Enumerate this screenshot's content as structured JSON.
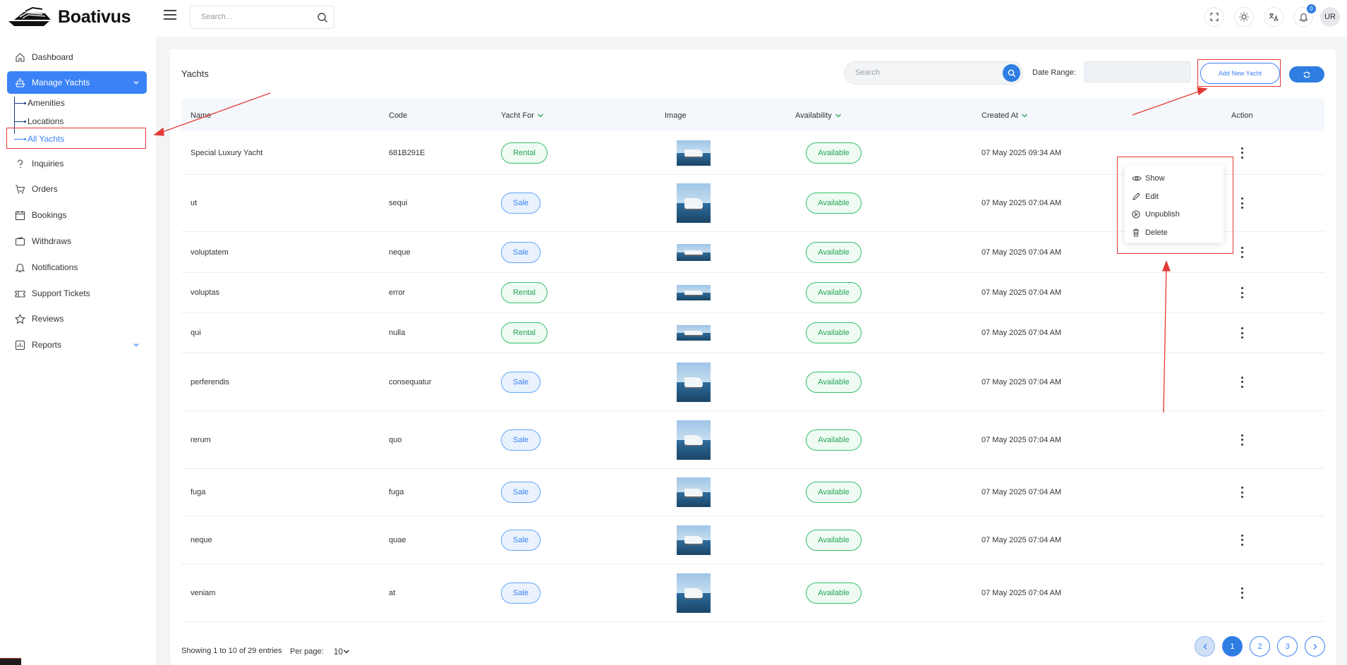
{
  "app": {
    "brand": "Boativus",
    "search_placeholder": "Search...",
    "notification_count": "0",
    "user_initials": "UR"
  },
  "sidebar": {
    "items": [
      {
        "label": "Dashboard",
        "icon": "home-icon"
      },
      {
        "label": "Manage Yachts",
        "icon": "ship-icon"
      },
      {
        "label": "Inquiries",
        "icon": "question-icon"
      },
      {
        "label": "Orders",
        "icon": "cart-icon"
      },
      {
        "label": "Bookings",
        "icon": "calendar-icon"
      },
      {
        "label": "Withdraws",
        "icon": "wallet-icon"
      },
      {
        "label": "Notifications",
        "icon": "bell-icon"
      },
      {
        "label": "Support Tickets",
        "icon": "ticket-icon"
      },
      {
        "label": "Reviews",
        "icon": "star-icon"
      },
      {
        "label": "Reports",
        "icon": "report-icon"
      }
    ],
    "sub_items": [
      "Amenities",
      "Locations",
      "All Yachts"
    ]
  },
  "page": {
    "title": "Yachts",
    "search_placeholder": "Search",
    "date_range_label": "Date Range:",
    "add_button": "Add New Yacht"
  },
  "table": {
    "columns": [
      "Name",
      "Code",
      "Yacht For",
      "Image",
      "Availability",
      "Created At",
      "Action"
    ],
    "rows": [
      {
        "name": "Special Luxury Yacht",
        "code": "681B291E",
        "yacht_for": "Rental",
        "availability": "Available",
        "created_at": "07 May 2025 09:34 AM"
      },
      {
        "name": "ut",
        "code": "sequi",
        "yacht_for": "Sale",
        "availability": "Available",
        "created_at": "07 May 2025 07:04 AM"
      },
      {
        "name": "voluptatem",
        "code": "neque",
        "yacht_for": "Sale",
        "availability": "Available",
        "created_at": "07 May 2025 07:04 AM"
      },
      {
        "name": "voluptas",
        "code": "error",
        "yacht_for": "Rental",
        "availability": "Available",
        "created_at": "07 May 2025 07:04 AM"
      },
      {
        "name": "qui",
        "code": "nulla",
        "yacht_for": "Rental",
        "availability": "Available",
        "created_at": "07 May 2025 07:04 AM"
      },
      {
        "name": "perferendis",
        "code": "consequatur",
        "yacht_for": "Sale",
        "availability": "Available",
        "created_at": "07 May 2025 07:04 AM"
      },
      {
        "name": "rerum",
        "code": "quo",
        "yacht_for": "Sale",
        "availability": "Available",
        "created_at": "07 May 2025 07:04 AM"
      },
      {
        "name": "fuga",
        "code": "fuga",
        "yacht_for": "Sale",
        "availability": "Available",
        "created_at": "07 May 2025 07:04 AM"
      },
      {
        "name": "neque",
        "code": "quae",
        "yacht_for": "Sale",
        "availability": "Available",
        "created_at": "07 May 2025 07:04 AM"
      },
      {
        "name": "veniam",
        "code": "at",
        "yacht_for": "Sale",
        "availability": "Available",
        "created_at": "07 May 2025 07:04 AM"
      }
    ]
  },
  "action_menu": [
    "Show",
    "Edit",
    "Unpublish",
    "Delete"
  ],
  "footer": {
    "info": "Showing 1 to 10 of 29 entries",
    "per_page_label": "Per page:",
    "per_page_value": "10",
    "pages": [
      "1",
      "2",
      "3"
    ]
  },
  "colors": {
    "primary": "#2f7de1",
    "rental": "#21a355",
    "annotation": "#e53935"
  }
}
